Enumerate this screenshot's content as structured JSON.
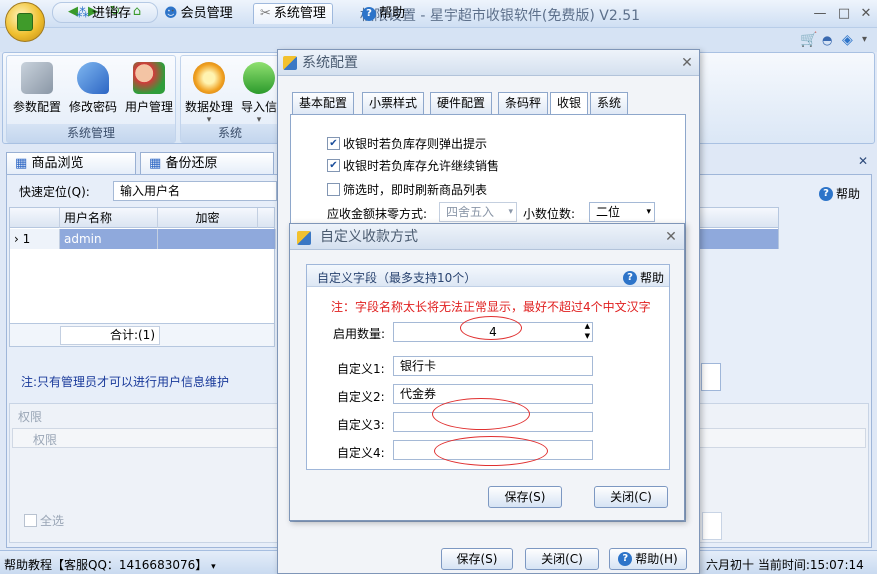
{
  "window": {
    "title": "权限设置 - 星宇超市收银软件(免费版) V2.51"
  },
  "ribbon_tabs": [
    {
      "label": "进销存",
      "icon": "dots-icon"
    },
    {
      "label": "会员管理",
      "icon": "member-icon"
    },
    {
      "label": "系统管理",
      "icon": "tools-icon"
    },
    {
      "label": "帮助",
      "icon": "help-icon"
    }
  ],
  "ribbon": {
    "group1": {
      "label": "系统管理",
      "buttons": [
        "参数配置",
        "修改密码",
        "用户管理"
      ]
    },
    "group2": {
      "label": "系统",
      "buttons": [
        "数据处理",
        "导入信"
      ]
    }
  },
  "doc_tabs": [
    "商品浏览",
    "备份还原"
  ],
  "main": {
    "quick_locate_label": "快速定位(Q):",
    "quick_locate_value": "输入用户名",
    "help": "帮助",
    "grid": {
      "headers": [
        "用户名称",
        "加密"
      ],
      "rows": [
        {
          "num": "1",
          "name": "admin"
        }
      ],
      "total": "合计:(1)"
    },
    "note": "注:只有管理员才可以进行用户信息维护",
    "perm_section": "权限",
    "perm_header": "权限",
    "select_all": "全选"
  },
  "statusbar": {
    "left": "帮助教程【客服QQ：1416683076】",
    "right": "六月初十 当前时间:15:07:14"
  },
  "sysconfig": {
    "title": "系统配置",
    "tabs": [
      "基本配置",
      "小票样式",
      "硬件配置",
      "条码秤",
      "收银",
      "系统"
    ],
    "active_tab": "收银",
    "checks": [
      {
        "label": "收银时若负库存则弹出提示",
        "checked": true
      },
      {
        "label": "收银时若负库存允许继续销售",
        "checked": true
      },
      {
        "label": "筛选时，即时刷新商品列表",
        "checked": false
      }
    ],
    "rounding_label": "应收金额抹零方式:",
    "rounding_value": "四舍五入",
    "decimal_label": "小数位数:",
    "decimal_value": "二位",
    "save": "保存(S)",
    "close": "关闭(C)",
    "help": "帮助(H)"
  },
  "custom": {
    "title": "自定义收款方式",
    "group_title": "自定义字段（最多支持10个）",
    "help": "帮助",
    "note": "注：字段名称太长将无法正常显示，最好不超过4个中文汉字",
    "count_label": "启用数量:",
    "count_value": "4",
    "fields": [
      {
        "label": "自定义1:",
        "value": "银行卡"
      },
      {
        "label": "自定义2:",
        "value": "代金券"
      },
      {
        "label": "自定义3:",
        "value": ""
      },
      {
        "label": "自定义4:",
        "value": ""
      }
    ],
    "save": "保存(S)",
    "close": "关闭(C)"
  },
  "colors": {
    "accent": "#2d74c9",
    "note_red": "#e02020",
    "selection": "#8fa9dc"
  }
}
